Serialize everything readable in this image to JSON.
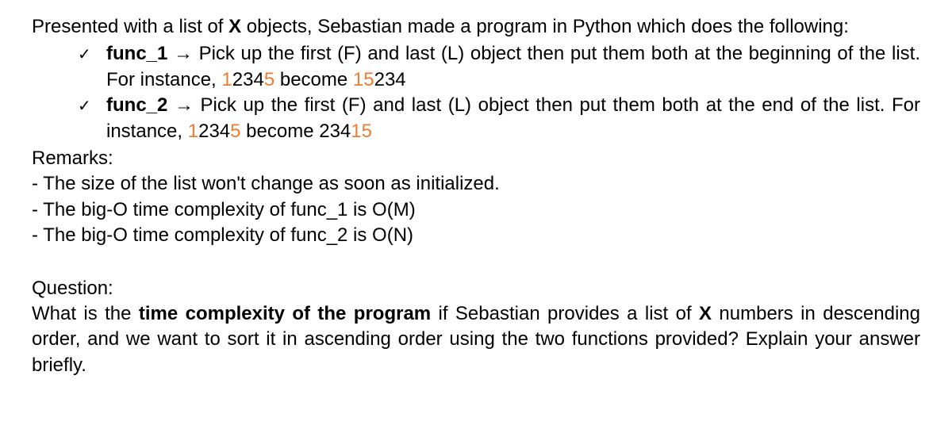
{
  "intro_pre": "Presented with a list of ",
  "intro_x": "X",
  "intro_post": " objects, Sebastian made a program in Python which does the following:",
  "func1": {
    "check": "✓",
    "name": "func_1",
    "arrow": " → ",
    "desc_pre": "Pick up the first (F) and last (L) object then put them both at the beginning of the list. For instance, ",
    "ex_a1": "1",
    "ex_a2": "234",
    "ex_a3": "5",
    "become": " become ",
    "ex_b1": "15",
    "ex_b2": "234"
  },
  "func2": {
    "check": "✓",
    "name": "func_2",
    "arrow": " → ",
    "desc_pre": "Pick up the first (F) and last (L) object then put them both at the end of the list. For instance, ",
    "ex_a1": "1",
    "ex_a2": "234",
    "ex_a3": "5",
    "become": " become ",
    "ex_b1": "234",
    "ex_b2": "15"
  },
  "remarks_label": "Remarks:",
  "remarks": [
    "- The size of the list won't change as soon as initialized.",
    "- The big-O time complexity of func_1 is O(M)",
    "- The big-O time complexity of func_2 is O(N)"
  ],
  "question_label": "Question:",
  "question": {
    "pre": "What is the ",
    "bold": "time complexity of the program",
    "mid": " if Sebastian provides a list of ",
    "x": "X",
    "post": " numbers in descending order, and we want to sort it in ascending order using the two functions provided? Explain your answer briefly."
  }
}
